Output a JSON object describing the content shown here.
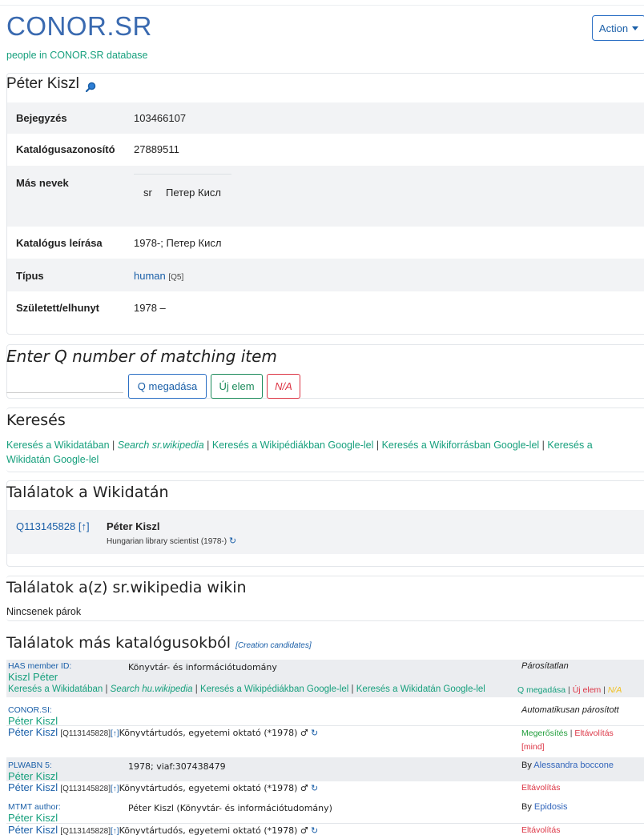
{
  "app": {
    "title": "CONOR.SR",
    "subtitle": "people in CONOR.SR database",
    "action_label": "Action"
  },
  "person": {
    "name": "Péter Kiszl",
    "rows": [
      {
        "label": "Bejegyzés",
        "value": "103466107"
      },
      {
        "label": "Katalógusazonosító",
        "value": "27889511"
      },
      {
        "label": "Más nevek",
        "lang": "sr",
        "value": "Петер Кисл"
      },
      {
        "label": "Katalógus leírása",
        "value": "1978-; Петер Кисл"
      },
      {
        "label": "Típus",
        "value": "human",
        "qid": "[Q5]"
      },
      {
        "label": "Született/elhunyt",
        "value": "1978 –"
      }
    ]
  },
  "enter_q": {
    "heading": "Enter Q number of matching item",
    "input_value": "",
    "btn_q": "Q megadása",
    "btn_new": "Új elem",
    "btn_na": "N/A"
  },
  "search": {
    "heading": "Keresés",
    "links": [
      "Keresés a Wikidatában",
      "Search sr.wikipedia",
      "Keresés a Wikipédiákban Google-lel",
      "Keresés a Wikiforrásban Google-lel",
      "Keresés a Wikidatán Google-lel"
    ],
    "sep": " | "
  },
  "wikidata_results": {
    "heading": "Találatok a Wikidatán",
    "item": {
      "qid": "Q113145828",
      "arrow": "[↑]",
      "name": "Péter Kiszl",
      "desc": "Hungarian library scientist (1978-)",
      "refresh": "↻"
    }
  },
  "wiki_results": {
    "heading": "Találatok a(z) sr.wikipedia wikin",
    "none": "Nincsenek párok"
  },
  "other": {
    "heading": "Találatok más katalógusokból",
    "candidates": "[Creation candidates]",
    "rows": [
      {
        "source": "HAS member ID:",
        "name": "Kiszl Péter",
        "desc": "Könyvtár- és információtudomány",
        "status": "Párosítatlan",
        "links": [
          "Keresés a Wikidatában",
          "Search hu.wikipedia",
          "Keresés a Wikipédiákban Google-lel",
          "Keresés a Wikidatán Google-lel"
        ],
        "actions": [
          "Q megadása",
          "Új elem",
          "N/A"
        ]
      },
      {
        "source": "CONOR.SI:",
        "name": "Péter Kiszl",
        "desc": "",
        "status": "Automatikusan párosított",
        "match": {
          "name": "Péter Kiszl",
          "qid": "[Q113145828]",
          "arrow": "[↑]",
          "desc": "Könyvtártudós, egyetemi oktató (*1978) ♂",
          "refresh": "↻"
        },
        "actions": [
          "Megerősítés",
          "Eltávolítás",
          "[mind]"
        ]
      },
      {
        "source": "PLWABN 5:",
        "name": "Péter Kiszl",
        "desc": "1978; viaf:307438479",
        "status_prefix": "By ",
        "status_user": "Alessandra boccone",
        "match": {
          "name": "Péter Kiszl",
          "qid": "[Q113145828]",
          "arrow": "[↑]",
          "desc": "Könyvtártudós, egyetemi oktató (*1978) ♂",
          "refresh": "↻"
        },
        "actions": [
          "Eltávolítás"
        ]
      },
      {
        "source": "MTMT author:",
        "name": "Péter Kiszl",
        "desc": "Péter Kiszl (Könyvtár- és információtudomány)",
        "status_prefix": "By ",
        "status_user": "Epidosis",
        "match": {
          "name": "Péter Kiszl",
          "qid": "[Q113145828]",
          "arrow": "[↑]",
          "desc": "Könyvtártudós, egyetemi oktató (*1978) ♂",
          "refresh": "↻"
        },
        "actions": [
          "Eltávolítás"
        ]
      }
    ]
  }
}
